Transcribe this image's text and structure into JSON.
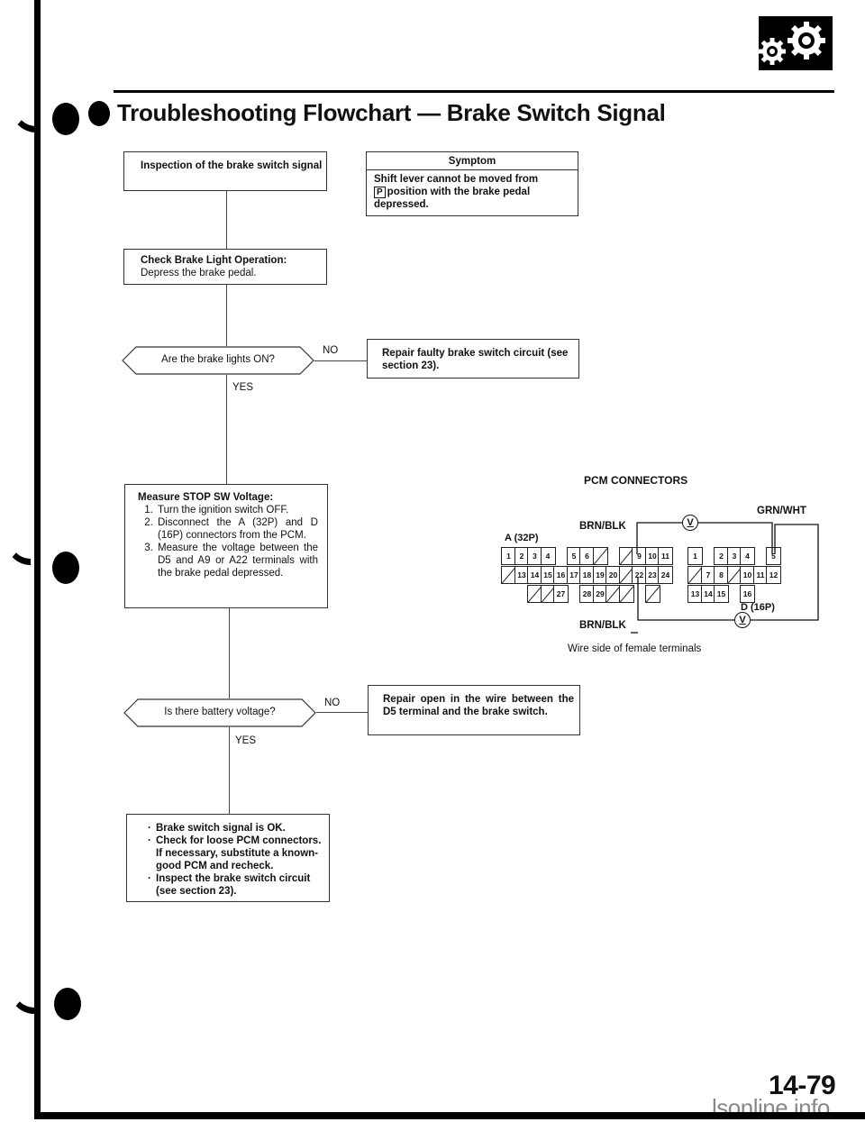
{
  "header": {
    "title": "Troubleshooting Flowchart — Brake Switch Signal",
    "section_icon": "gears-icon"
  },
  "symptom": {
    "heading": "Symptom",
    "badge": "P",
    "text_before": "Shift lever cannot be moved from",
    "text_after": "position with the brake pedal depressed."
  },
  "flow": {
    "start": "Inspection of the brake switch signal",
    "check_lights": {
      "title": "Check Brake Light Operation:",
      "text": "Depress the brake pedal."
    },
    "decision_1": {
      "question": "Are the brake lights ON?",
      "no_label": "NO",
      "yes_label": "YES",
      "no_action": "Repair faulty brake switch circuit (see section 23)."
    },
    "measure": {
      "title": "Measure STOP SW Voltage:",
      "steps": [
        "Turn the ignition switch OFF.",
        "Disconnect the A (32P) and D (16P) connectors from the PCM.",
        "Measure the voltage between the D5 and A9 or A22 terminals with the brake pedal depressed."
      ]
    },
    "decision_2": {
      "question": "Is there battery voltage?",
      "no_label": "NO",
      "yes_label": "YES",
      "no_action": "Repair open in the wire between the D5 terminal and the brake switch."
    },
    "result": {
      "bullets": [
        "Brake switch signal is OK.",
        "Check for loose PCM connectors. If necessary, substitute a known-good PCM and recheck.",
        "Inspect the brake switch circuit (see section 23)."
      ]
    }
  },
  "connector": {
    "title": "PCM CONNECTORS",
    "connector_a": "A (32P)",
    "connector_d": "D (16P)",
    "wire_top_left": "BRN/BLK",
    "wire_top_right": "GRN/WHT",
    "wire_bottom": "BRN/BLK",
    "voltmeter_symbol": "V",
    "caption": "Wire side of female terminals",
    "a_terminals": {
      "row1": [
        "1",
        "2",
        "3",
        "4",
        "",
        "5",
        "6",
        "/",
        "",
        "/",
        "9",
        "10",
        "11"
      ],
      "row2": [
        "/",
        "13",
        "14",
        "15",
        "16",
        "17",
        "18",
        "19",
        "20",
        "/",
        "22",
        "23",
        "24"
      ],
      "row3": [
        "",
        "",
        "/",
        "/",
        "27",
        "",
        "28",
        "29",
        "/",
        "/",
        "",
        "/",
        ""
      ]
    },
    "d_terminals": {
      "row1": [
        "1",
        "",
        "2",
        "3",
        "4",
        "",
        "5"
      ],
      "row2": [
        "/",
        "7",
        "8",
        "/",
        "10",
        "11",
        "12"
      ],
      "row3": [
        "13",
        "14",
        "15",
        "",
        "16",
        "",
        ""
      ]
    }
  },
  "footer": {
    "page_number": "14-79",
    "watermark": "lsonline.info"
  }
}
